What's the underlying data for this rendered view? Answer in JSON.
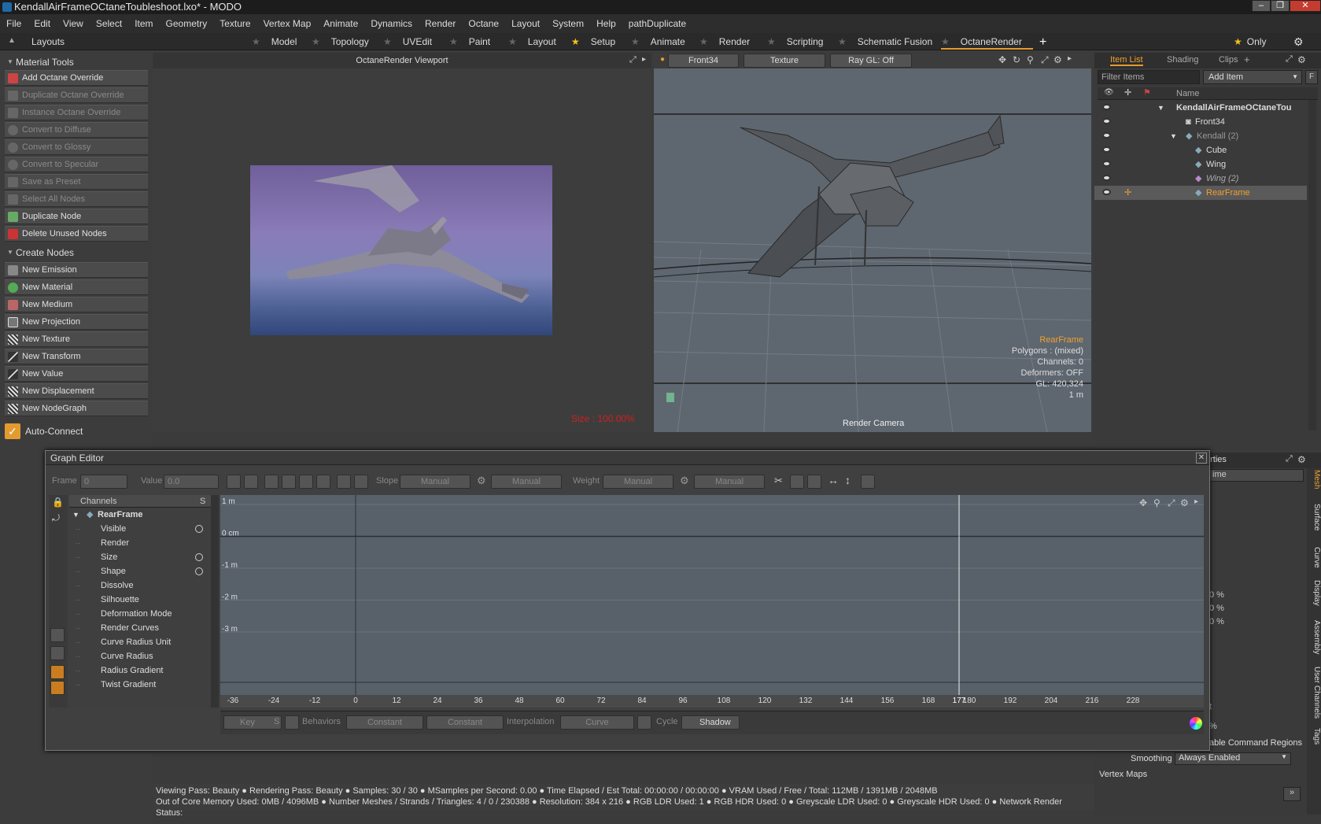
{
  "window": {
    "title": "KendallAirFrameOCtaneToubleshoot.lxo* - MODO",
    "buttons": [
      "–",
      "❐",
      "✕"
    ]
  },
  "menu": [
    "File",
    "Edit",
    "View",
    "Select",
    "Item",
    "Geometry",
    "Texture",
    "Vertex Map",
    "Animate",
    "Dynamics",
    "Render",
    "Octane",
    "Layout",
    "System",
    "Help",
    "pathDuplicate"
  ],
  "tabs": {
    "layouts": "Layouts",
    "items": [
      "Model",
      "Topology",
      "UVEdit",
      "Paint",
      "Layout",
      "Setup",
      "Animate",
      "Render",
      "Scripting",
      "Schematic Fusion",
      "OctaneRender"
    ],
    "plus": "+",
    "only": "Only"
  },
  "material_tools": {
    "header": "Material Tools",
    "items": [
      "Add Octane Override",
      "Duplicate Octane Override",
      "Instance Octane Override",
      "Convert to Diffuse",
      "Convert to Glossy",
      "Convert to Specular",
      "Save as Preset",
      "Select All Nodes",
      "Duplicate Node",
      "Delete Unused Nodes"
    ]
  },
  "create_nodes": {
    "header": "Create Nodes",
    "items": [
      "New Emission",
      "New Material",
      "New Medium",
      "New Projection",
      "New Texture",
      "New Transform",
      "New Value",
      "New Displacement",
      "New NodeGraph"
    ]
  },
  "auto_connect": "Auto-Connect",
  "octane_viewport": {
    "title": "OctaneRender Viewport",
    "size": "Size : 100.00%"
  },
  "viewport3d": {
    "camera": "Front34",
    "shading": "Texture",
    "raygl": "Ray GL: Off",
    "info": [
      "RearFrame",
      "Polygons : (mixed)",
      "Channels: 0",
      "Deformers: OFF",
      "GL: 420,324",
      "1 m"
    ],
    "render_camera": "Render Camera"
  },
  "itemlist": {
    "tabs": [
      "Item List",
      "Shading",
      "Clips",
      "+"
    ],
    "filter": "Filter Items",
    "add_item": "Add Item",
    "f": "F",
    "name_col": "Name",
    "rows": [
      "KendallAirFrameOCtaneTou",
      "Front34",
      "Kendall (2)",
      "Cube",
      "Wing",
      "Wing (2)",
      "RearFrame"
    ]
  },
  "graph_editor": {
    "title": "Graph Editor",
    "frame_label": "Frame",
    "frame_val": "0",
    "value_label": "Value",
    "value_val": "0.0",
    "slope": "Slope",
    "manual1": "Manual",
    "manual2": "Manual",
    "weight": "Weight",
    "manual3": "Manual",
    "manual4": "Manual",
    "channels_header": "Channels",
    "s_header": "S",
    "root": "RearFrame",
    "channels": [
      "Visible",
      "Render",
      "Size",
      "Shape",
      "Dissolve",
      "Silhouette",
      "Deformation Mode",
      "Render Curves",
      "Curve Radius Unit",
      "Curve Radius",
      "Radius Gradient",
      "Twist Gradient"
    ],
    "y_ticks": [
      "1 m",
      "0 cm",
      "-1 m",
      "-2 m",
      "-3 m"
    ],
    "x_ticks": [
      "-36",
      "-24",
      "-12",
      "0",
      "12",
      "24",
      "36",
      "48",
      "60",
      "72",
      "84",
      "96",
      "108",
      "120",
      "132",
      "144",
      "156",
      "168",
      "177",
      "180",
      "192",
      "204",
      "216",
      "228"
    ],
    "key": "Key",
    "s": "S",
    "behaviors": "Behaviors",
    "constant1": "Constant",
    "constant2": "Constant",
    "interpolation": "Interpolation",
    "curve": "Curve",
    "cycle": "Cycle",
    "shadow": "Shadow"
  },
  "properties": {
    "title": "erties",
    "field": "ime",
    "percent": [
      "0 %",
      "0 %",
      "0 %"
    ],
    "t": "t",
    "pct": "%",
    "command_regions": "able Command Regions",
    "smoothing_label": "Smoothing",
    "smoothing_val": "Always Enabled",
    "vertex_maps": "Vertex Maps",
    "vtabs": [
      "Mesh",
      "Surface",
      "Curve",
      "Display",
      "Assembly",
      "User Channels",
      "Tags"
    ]
  },
  "status": {
    "line1": "Viewing Pass: Beauty ● Rendering Pass: Beauty ● Samples: 30 / 30 ● MSamples per Second: 0.00 ● Time Elapsed / Est Total: 00:00:00 / 00:00:00 ● VRAM Used / Free / Total: 112MB / 1391MB / 2048MB",
    "line2": "Out of Core Memory Used: 0MB / 4096MB ● Number Meshes / Strands / Triangles: 4 / 0 / 230388 ● Resolution: 384 x 216 ● RGB LDR Used: 1 ● RGB HDR Used: 0 ● Greyscale LDR Used: 0 ● Greyscale HDR Used: 0 ● Network Render Status:"
  }
}
